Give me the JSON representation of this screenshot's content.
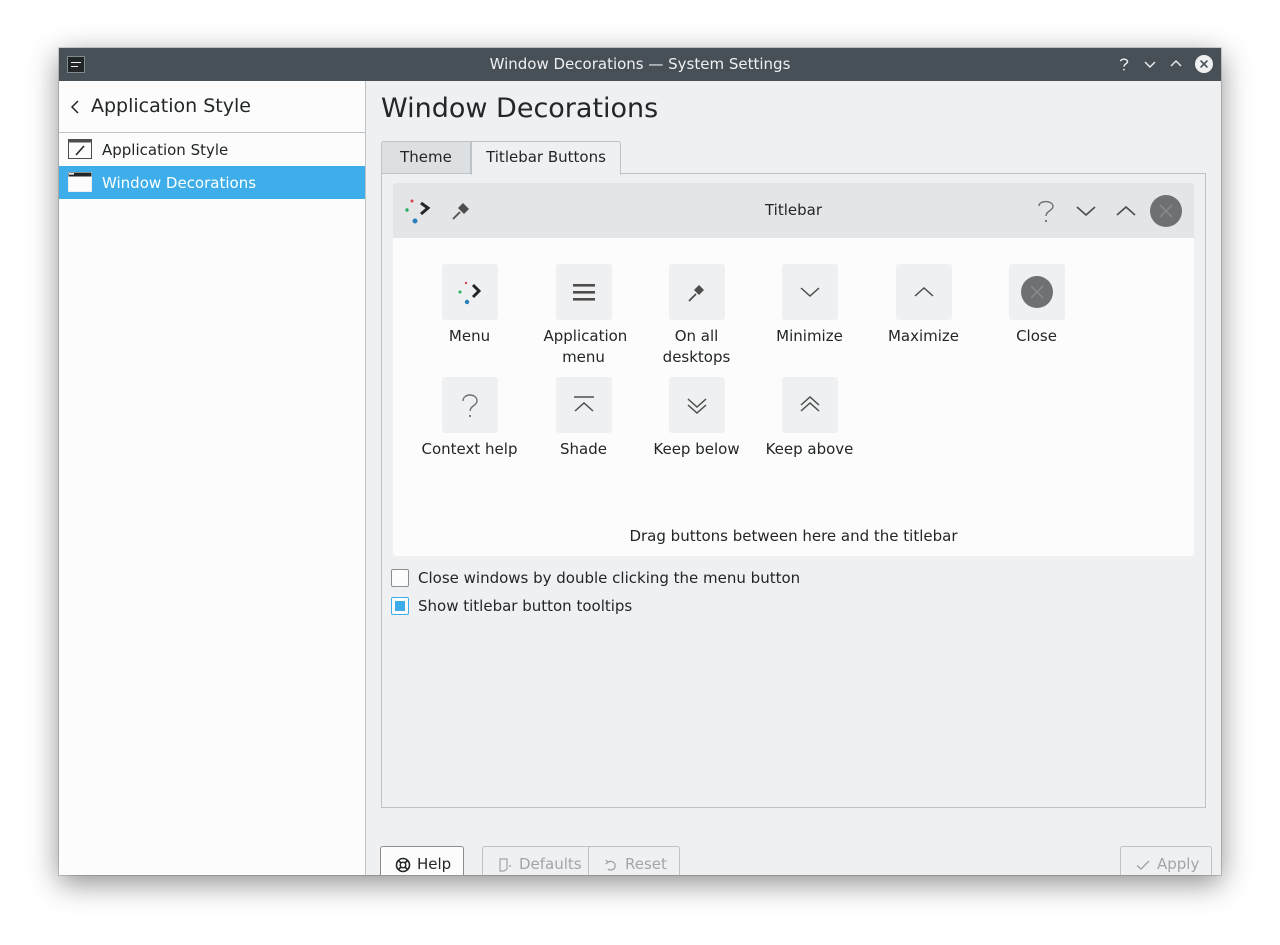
{
  "window": {
    "title": "Window Decorations — System Settings"
  },
  "sidebar": {
    "back_label": "Application Style",
    "items": [
      {
        "label": "Application Style",
        "icon": "application-style-icon",
        "active": false
      },
      {
        "label": "Window Decorations",
        "icon": "window-decorations-icon",
        "active": true
      }
    ]
  },
  "main": {
    "page_title": "Window Decorations",
    "tabs": [
      {
        "label": "Theme",
        "active": false
      },
      {
        "label": "Titlebar Buttons",
        "active": true
      }
    ],
    "preview": {
      "title": "Titlebar",
      "left_buttons": [
        "menu-icon",
        "pin-icon"
      ],
      "right_buttons": [
        "help-icon",
        "minimize-icon",
        "maximize-icon",
        "close-icon"
      ]
    },
    "available_buttons": [
      {
        "label": "Menu",
        "icon": "menu-dots-icon"
      },
      {
        "label": "Application menu",
        "icon": "hamburger-icon"
      },
      {
        "label": "On all desktops",
        "icon": "pin-icon"
      },
      {
        "label": "Minimize",
        "icon": "chevron-down-icon"
      },
      {
        "label": "Maximize",
        "icon": "chevron-up-icon"
      },
      {
        "label": "Close",
        "icon": "close-circle-icon"
      },
      {
        "label": "Context help",
        "icon": "question-icon"
      },
      {
        "label": "Shade",
        "icon": "shade-icon"
      },
      {
        "label": "Keep below",
        "icon": "double-chevron-down-icon"
      },
      {
        "label": "Keep above",
        "icon": "double-chevron-up-icon"
      }
    ],
    "drag_hint": "Drag buttons between here and the titlebar",
    "options": [
      {
        "label": "Close windows by double clicking the menu button",
        "checked": false
      },
      {
        "label": "Show titlebar button tooltips",
        "checked": true
      }
    ]
  },
  "footer": {
    "help": "Help",
    "defaults": "Defaults",
    "reset": "Reset",
    "apply": "Apply"
  },
  "colors": {
    "accent": "#3daee9",
    "titlebar": "#475057",
    "window_bg": "#eff0f1",
    "view_bg": "#fcfcfc"
  }
}
